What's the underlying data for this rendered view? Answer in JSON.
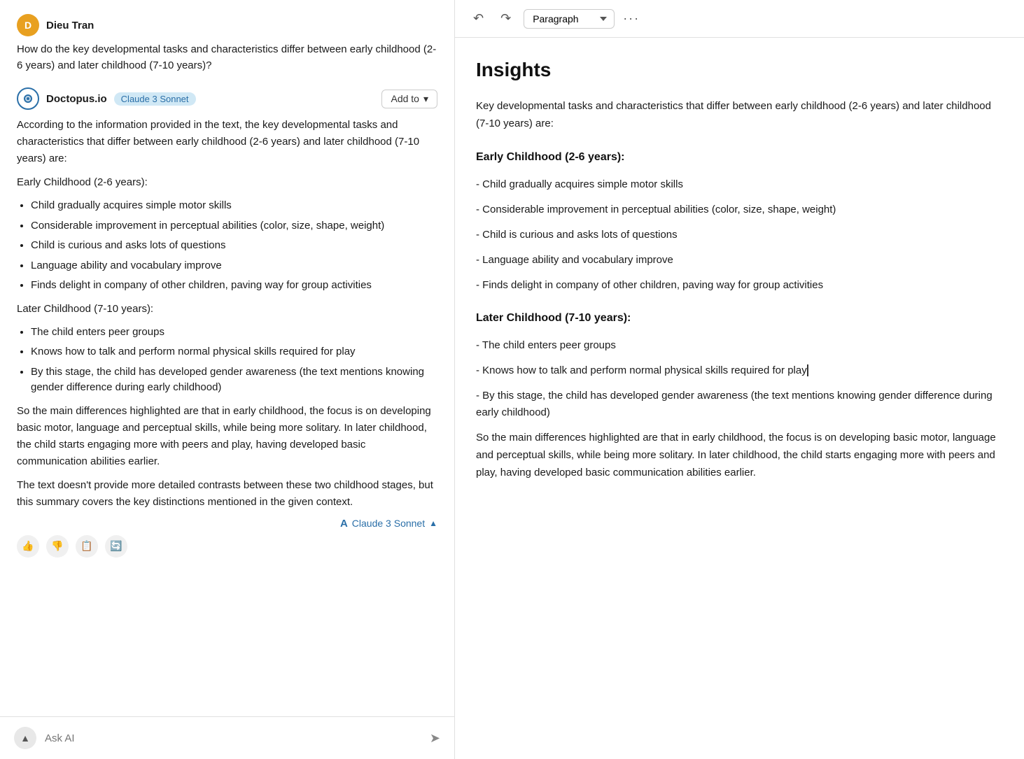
{
  "user": {
    "initial": "D",
    "name": "Dieu Tran",
    "avatar_color": "#e8a020"
  },
  "question": "How do the key developmental tasks and characteristics differ between early childhood (2-6 years) and later childhood (7-10 years)?",
  "bot": {
    "name": "Doctopus.io",
    "badge": "Claude 3 Sonnet",
    "add_to_label": "Add to",
    "intro": "According to the information provided in the text, the key developmental tasks and characteristics that differ between early childhood (2-6 years) and later childhood (7-10 years) are:",
    "early_heading": "Early Childhood (2-6 years):",
    "early_intro": "Early Childhood (2-6 years):",
    "early_bullets": [
      "Child gradually acquires simple motor skills",
      "Considerable improvement in perceptual abilities (color, size, shape, weight)",
      "Child is curious and asks lots of questions",
      "Language ability and vocabulary improve",
      "Finds delight in company of other children, paving way for group activities"
    ],
    "later_intro": "Later Childhood (7-10 years):",
    "later_heading": "Later Childhood (7-10 years):",
    "later_bullets": [
      "The child enters peer groups",
      "Knows how to talk and perform normal physical skills required for play",
      "By this stage, the child has developed gender awareness (the text mentions knowing gender difference during early childhood)"
    ],
    "summary": "So the main differences highlighted are that in early childhood, the focus is on developing basic motor, language and perceptual skills, while being more solitary. In later childhood, the child starts engaging more with peers and play, having developed basic communication abilities earlier.",
    "addendum": "The text doesn't provide more detailed contrasts between these two childhood stages, but this summary covers the key distinctions mentioned in the given context.",
    "footer_label": "Claude 3 Sonnet"
  },
  "toolbar": {
    "paragraph_label": "Paragraph",
    "more_icon": "···"
  },
  "insights": {
    "title": "Insights",
    "intro": "Key developmental tasks and characteristics that differ between early childhood (2-6 years) and later childhood (7-10 years) are:",
    "early_heading": "Early Childhood (2-6 years):",
    "early_items": [
      "Child gradually acquires simple motor skills",
      "Considerable improvement in perceptual abilities (color, size, shape, weight)",
      "Child is curious and asks lots of questions",
      "Language ability and vocabulary improve",
      "Finds delight in company of other children, paving way for group activities"
    ],
    "later_heading": "Later Childhood (7-10 years):",
    "later_items": [
      "The child enters peer groups",
      "Knows how to talk and perform normal physical skills required for play",
      "By this stage, the child has developed gender awareness (the text mentions knowing gender difference during early childhood)"
    ],
    "summary": "So the main differences highlighted are that in early childhood, the focus is on developing basic motor, language and perceptual skills, while being more",
    "summary_full": "So the main differences highlighted are that in early childhood, the focus is on developing basic motor, language and perceptual skills, while being more solitary. In later childhood, the child starts engaging more with peers and play, having developed basic communication abilities earlier."
  },
  "input_placeholder": "Ask AI",
  "actions": [
    "👍",
    "👎",
    "📋",
    "🔄"
  ]
}
